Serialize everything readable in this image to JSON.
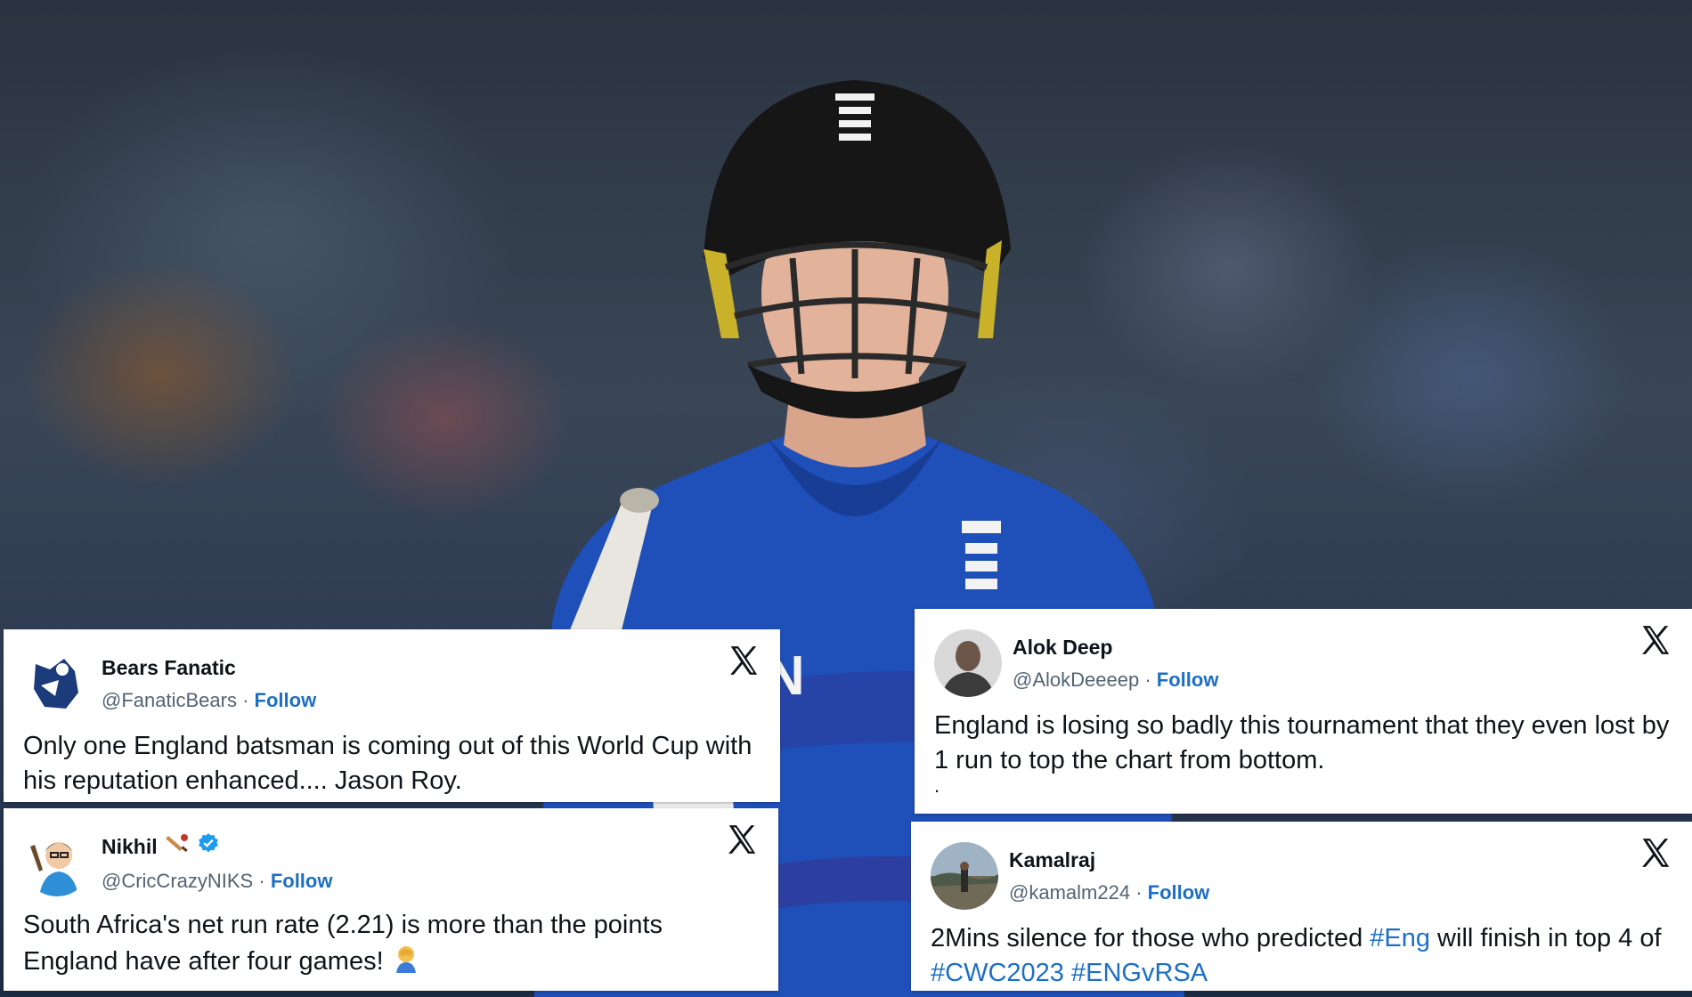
{
  "tweets": [
    {
      "id": "t1",
      "name": "Bears Fanatic",
      "handle": "@FanaticBears",
      "separator": "·",
      "follow": "Follow",
      "text": "Only one England batsman is coming out of this World Cup with his reputation enhanced.... Jason Roy.",
      "avatar": "bears-logo-avatar"
    },
    {
      "id": "t2",
      "name": "Alok Deep",
      "handle": "@AlokDeeeep",
      "separator": "·",
      "follow": "Follow",
      "text": "England is losing so badly this tournament that they even lost by 1 run to top the chart from bottom.",
      "trailing": ".",
      "avatar": "person-photo-avatar"
    },
    {
      "id": "t3",
      "name": "Nikhil",
      "handle": "@CricCrazyNIKS",
      "separator": "·",
      "follow": "Follow",
      "text": "South Africa's net run rate (2.21) is more than the points England have after four games!",
      "name_emoji": "cricket-bat-icon",
      "verified": true,
      "text_emoji": "facepalm-emoji",
      "avatar": "cartoon-avatar"
    },
    {
      "id": "t4",
      "name": "Kamalraj",
      "handle": "@kamalm224",
      "separator": "·",
      "follow": "Follow",
      "text_parts": [
        "2Mins silence for those who predicted ",
        "#Eng",
        " will finish in top 4 of ",
        "#CWC2023",
        " ",
        "#ENGvRSA"
      ],
      "avatar": "landscape-photo-avatar"
    }
  ],
  "jersey_text": "GLAN",
  "colors": {
    "link": "#1d6fc4",
    "jersey": "#1f4fb8",
    "text": "#0f1419",
    "muted": "#536471"
  }
}
